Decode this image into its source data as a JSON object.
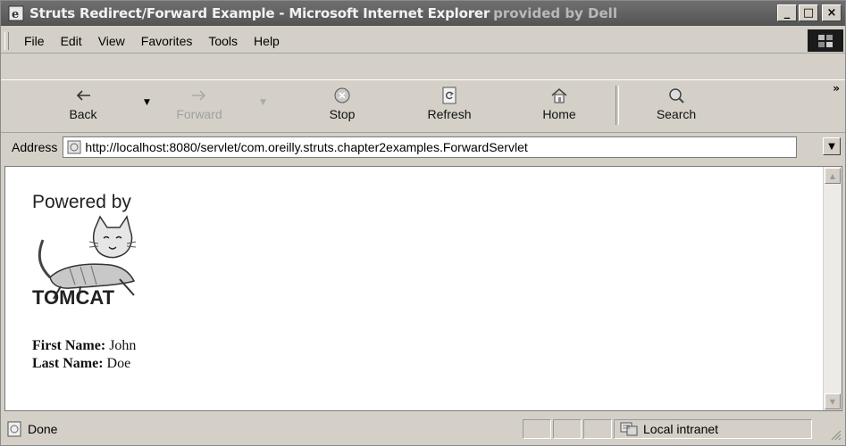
{
  "window": {
    "title": "Struts Redirect/Forward Example - Microsoft Internet Explorer",
    "title_suffix": "provided by Dell",
    "controls": {
      "minimize": "_",
      "maximize": "□",
      "close": "×"
    }
  },
  "menu": [
    {
      "label": "File"
    },
    {
      "label": "Edit"
    },
    {
      "label": "View"
    },
    {
      "label": "Favorites"
    },
    {
      "label": "Tools"
    },
    {
      "label": "Help"
    }
  ],
  "toolbar": {
    "back": {
      "label": "Back",
      "icon": "back-arrow-icon"
    },
    "forward": {
      "label": "Forward",
      "icon": "forward-arrow-icon",
      "enabled": false
    },
    "stop": {
      "label": "Stop",
      "icon": "stop-icon"
    },
    "refresh": {
      "label": "Refresh",
      "icon": "refresh-icon"
    },
    "home": {
      "label": "Home",
      "icon": "home-icon"
    },
    "search": {
      "label": "Search",
      "icon": "search-icon"
    },
    "more": "»"
  },
  "address": {
    "label": "Address",
    "url": "http://localhost:8080/servlet/com.oreilly.struts.chapter2examples.ForwardServlet"
  },
  "page": {
    "powered_by": "Powered by",
    "logo_text": "TOMCAT",
    "first_name_label": "First Name:",
    "first_name_value": "John",
    "last_name_label": "Last Name:",
    "last_name_value": "Doe"
  },
  "status": {
    "text": "Done",
    "zone": "Local intranet"
  },
  "colors": {
    "titlebar": "#5f5f5f",
    "chrome": "#d4d0c8",
    "content_bg": "#ffffff"
  }
}
